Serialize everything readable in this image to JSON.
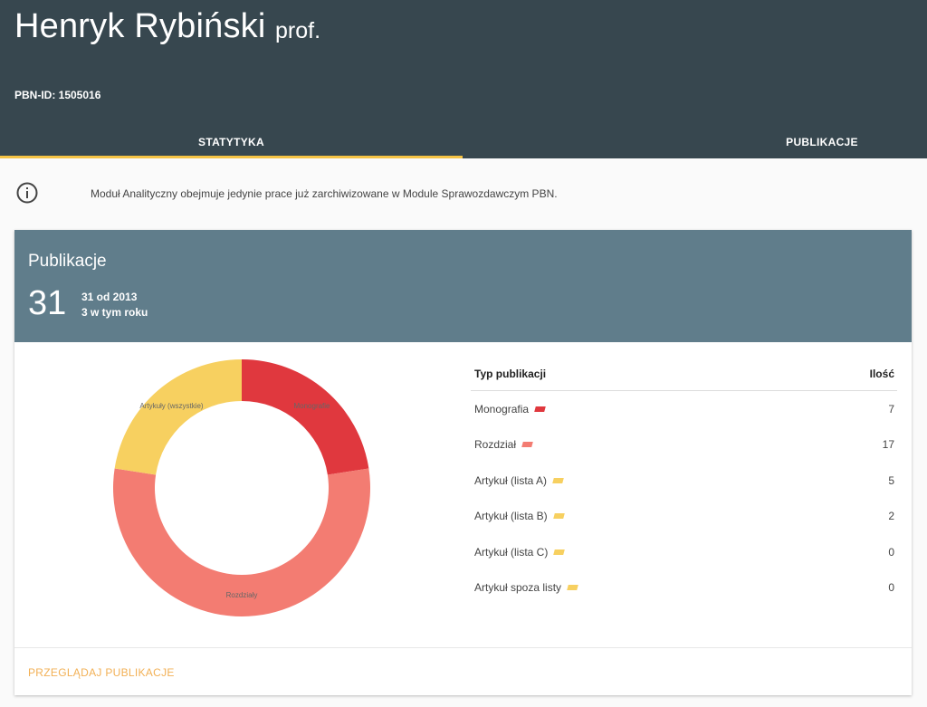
{
  "header": {
    "name": "Henryk Rybiński",
    "title": "prof.",
    "pbn_id": "PBN-ID: 1505016"
  },
  "tabs": [
    {
      "label": "STATYTYKA",
      "active": true
    },
    {
      "label": "PUBLIKACJE",
      "active": false
    }
  ],
  "info": {
    "icon": "info-icon",
    "text": "Moduł Analityczny obejmuje jedynie prace już zarchiwizowane w Module Sprawozdawczym PBN."
  },
  "card": {
    "title": "Publikacje",
    "total": "31",
    "since": "31 od 2013",
    "this_year": "3 w tym roku",
    "footer_link": "PRZEGLĄDAJ PUBLIKACJE"
  },
  "table": {
    "col_type": "Typ publikacji",
    "col_count": "Ilość",
    "rows": [
      {
        "label": "Monografia",
        "value": "7",
        "color": "#e0383e"
      },
      {
        "label": "Rozdział",
        "value": "17",
        "color": "#f37c72"
      },
      {
        "label": "Artykuł (lista A)",
        "value": "5",
        "color": "#f7d060"
      },
      {
        "label": "Artykuł (lista B)",
        "value": "2",
        "color": "#f7d060"
      },
      {
        "label": "Artykuł (lista C)",
        "value": "0",
        "color": "#f7d060"
      },
      {
        "label": "Artykuł spoza listy",
        "value": "0",
        "color": "#f7d060"
      }
    ]
  },
  "chart_data": {
    "type": "pie",
    "categories": [
      "Monografie",
      "Rozdziały",
      "Artykuły (wszystkie)"
    ],
    "values": [
      7,
      17,
      7
    ],
    "colors": [
      "#e0383e",
      "#f37c72",
      "#f7d060"
    ]
  }
}
